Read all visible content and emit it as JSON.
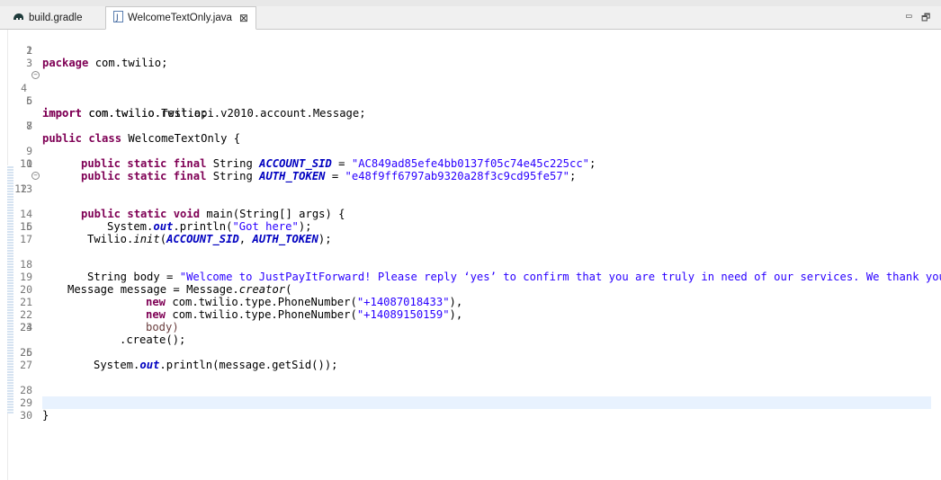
{
  "tabs": [
    {
      "label": "build.gradle",
      "icon": "gradle-elephant-icon",
      "active": false
    },
    {
      "label": "WelcomeTextOnly.java",
      "icon": "java-file-icon",
      "active": true,
      "close": "⊠"
    }
  ],
  "window_controls": {
    "minimize": "▭",
    "restore": "🗗"
  },
  "line_numbers": [
    "1",
    "2",
    "3",
    "4",
    "5",
    "6",
    "7",
    "8",
    "9",
    "10",
    "11",
    "12",
    "13",
    "14",
    "15",
    "16",
    "17",
    "18",
    "19",
    "20",
    "21",
    "22",
    "23",
    "24",
    "25",
    "26",
    "27",
    "28",
    "29",
    "30"
  ],
  "code": {
    "l1a": "package",
    "l1b": " com.twilio;",
    "l4a": "import",
    "l4b": " com.twilio.Twilio;",
    "l5a": "import",
    "l5b": " com.twilio.rest.api.v2010.account.Message;",
    "l7a": "public class",
    "l7b": " WelcomeTextOnly {",
    "l9a": "public static final",
    "l9b": " String ",
    "l9c": "ACCOUNT_SID",
    "l9d": " = ",
    "l9e": "\"AC849ad85efe4bb0137f05c74e45c225cc\"",
    "l9f": ";",
    "l10a": "public static final",
    "l10b": " String ",
    "l10c": "AUTH_TOKEN",
    "l10d": " = ",
    "l10e": "\"e48f9ff6797ab9320a28f3c9cd95fe57\"",
    "l10f": ";",
    "l12a": "public static void",
    "l12b": " main(String[] args) {",
    "l14a": "System.",
    "l14b": "out",
    "l14c": ".println(",
    "l14d": "\"Got here\"",
    "l14e": ");",
    "l15a": "Twilio.",
    "l15b": "init",
    "l15c": "(",
    "l15d": "ACCOUNT_SID",
    "l15e": ", ",
    "l15f": "AUTH_TOKEN",
    "l15g": ");",
    "l18a": "String body = ",
    "l18b": "\"Welcome to JustPayItForward! Please reply ‘yes’ to confirm that you are truly in need of our services. We thank you",
    "l19a": "Message message = Message.",
    "l19b": "creator",
    "l19c": "(",
    "l20a": "new",
    "l20b": " com.twilio.type.PhoneNumber(",
    "l20c": "\"+14087018433\"",
    "l20d": "),",
    "l21a": "new",
    "l21b": " com.twilio.type.PhoneNumber(",
    "l21c": "\"+14089150159\"",
    "l21d": "),",
    "l22": "body)",
    "l23": ".create();",
    "l25a": "System.",
    "l25b": "out",
    "l25c": ".println(message.getSid());",
    "l28": "}",
    "l29": "}"
  }
}
